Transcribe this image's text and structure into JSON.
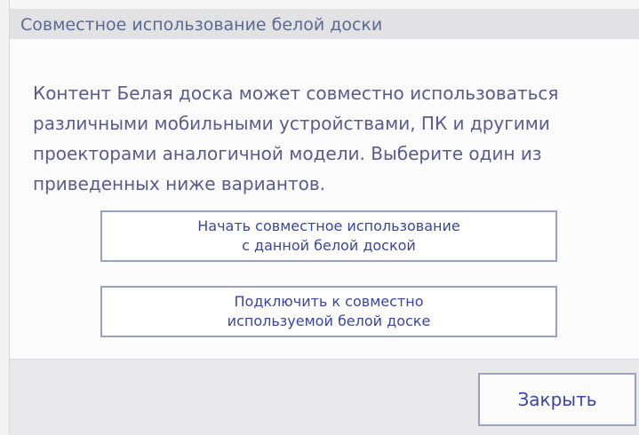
{
  "dialog": {
    "title": "Совместное использование белой доски",
    "description": "Контент Белая доска может совместно использоваться различными мобильными устройствами, ПК и другими проекторами аналогичной модели. Выберите один из приведенных ниже вариантов.",
    "start_button": {
      "line1": "Начать совместное использование",
      "line2": "с данной белой доской"
    },
    "connect_button": {
      "line1": "Подключить к совместно",
      "line2": "используемой белой доске"
    },
    "close_label": "Закрыть"
  },
  "colors": {
    "title_text": "#5b6a8e",
    "body_text": "#5b5b8e",
    "button_text": "#3a44a3",
    "button_border": "#9aa3bd"
  }
}
